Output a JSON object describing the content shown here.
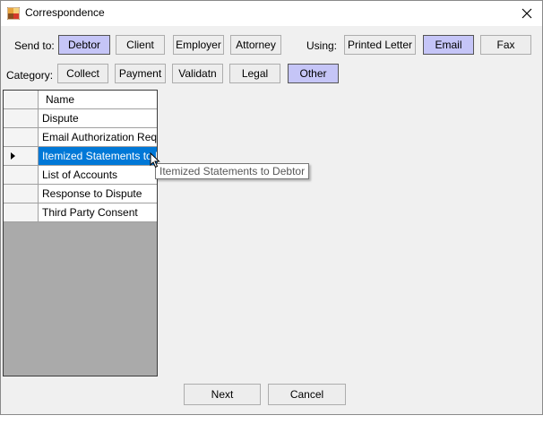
{
  "window": {
    "title": "Correspondence",
    "close_glyph": "✕"
  },
  "send_to": {
    "label": "Send to:",
    "options": [
      "Debtor",
      "Client",
      "Employer",
      "Attorney"
    ],
    "selected": "Debtor"
  },
  "using": {
    "label": "Using:",
    "options": [
      "Printed Letter",
      "Email",
      "Fax"
    ],
    "selected": "Email"
  },
  "category": {
    "label": "Category:",
    "options": [
      "Collect",
      "Payment",
      "Validatn",
      "Legal",
      "Other"
    ],
    "selected": "Other"
  },
  "grid": {
    "header": "Name",
    "rows": [
      "Dispute",
      "Email Authorization Requ...",
      "Itemized Statements to D...",
      "List of Accounts",
      "Response to Dispute",
      "Third Party Consent"
    ],
    "selected_index": 2
  },
  "tooltip": {
    "text": "Itemized Statements to Debtor"
  },
  "footer": {
    "next_label": "Next",
    "cancel_label": "Cancel"
  },
  "colors": {
    "selected_button": "#c5c5f7",
    "selected_row": "#0078d7"
  }
}
